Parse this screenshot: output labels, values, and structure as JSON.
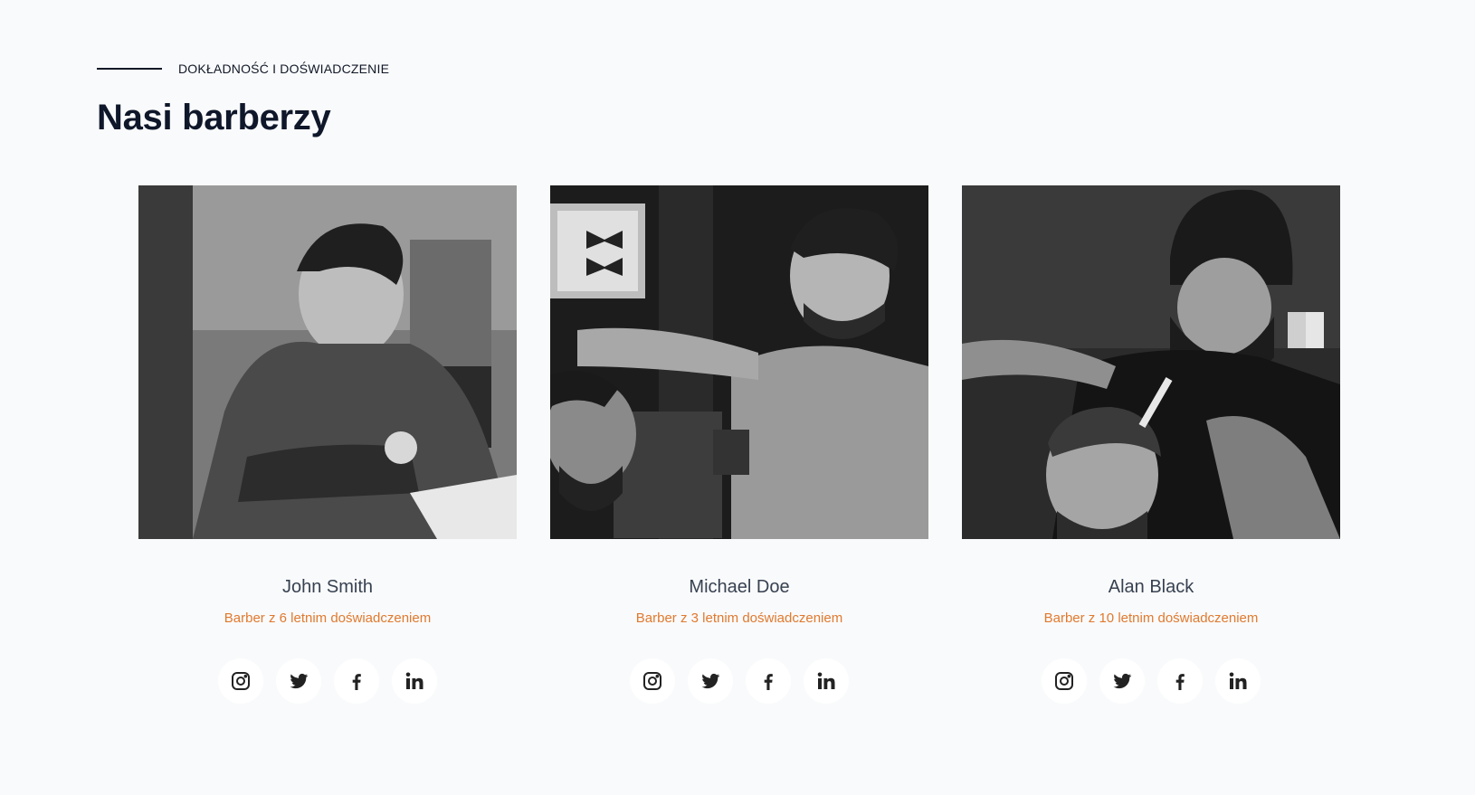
{
  "header": {
    "eyebrow": "DOKŁADNOŚĆ I DOŚWIADCZENIE",
    "title": "Nasi barberzy"
  },
  "barbers": [
    {
      "name": "John Smith",
      "role": "Barber z 6 letnim doświadczeniem"
    },
    {
      "name": "Michael Doe",
      "role": "Barber z 3 letnim doświadczeniem"
    },
    {
      "name": "Alan Black",
      "role": "Barber z 10 letnim doświadczeniem"
    }
  ],
  "social_icons": [
    "instagram-icon",
    "twitter-icon",
    "facebook-icon",
    "linkedin-icon"
  ],
  "colors": {
    "background": "#f9fafb",
    "accent": "#e07a2f",
    "heading": "#0f172a",
    "name": "#374151"
  }
}
